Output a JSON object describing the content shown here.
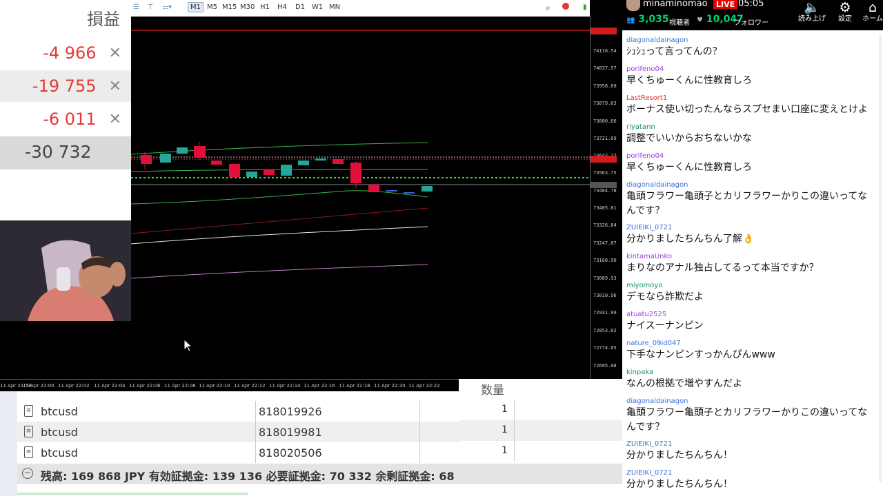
{
  "profit_panel": {
    "title": "損益",
    "rows": [
      {
        "value": "-4 966",
        "close": "✕"
      },
      {
        "value": "-19 755",
        "close": "✕"
      },
      {
        "value": "-6 011",
        "close": "✕"
      }
    ],
    "total": "-30 732"
  },
  "chart": {
    "timeframes": [
      "M1",
      "M5",
      "M15",
      "M30",
      "H1",
      "H4",
      "D1",
      "W1",
      "MN"
    ],
    "active_timeframe": "M1",
    "price_labels": [
      "74116.54",
      "74037.57",
      "73958.60",
      "73879.63",
      "73800.66",
      "73721.69",
      "73642.72",
      "73563.75",
      "73484.78",
      "73405.81",
      "73326.84",
      "73247.87",
      "73168.90",
      "73089.93",
      "73010.96",
      "72931.99",
      "72853.02",
      "72774.05",
      "72695.08"
    ],
    "time_labels": [
      "11 Apr 21:58",
      "11 Apr 22:00",
      "11 Apr 22:02",
      "11 Apr 22:04",
      "11 Apr 22:06",
      "11 Apr 22:08",
      "11 Apr 22:10",
      "11 Apr 22:12",
      "11 Apr 22:14",
      "11 Apr 22:16",
      "11 Apr 22:18",
      "11 Apr 22:20",
      "11 Apr 22:22"
    ],
    "colors": {
      "bull": "#26a69a",
      "bear": "#e0103a"
    }
  },
  "orders": {
    "rows": [
      {
        "symbol": "btcusd",
        "ticket": "818019926",
        "qty": "1"
      },
      {
        "symbol": "btcusd",
        "ticket": "818019981",
        "qty": "1"
      },
      {
        "symbol": "btcusd",
        "ticket": "818020506",
        "qty": "1"
      }
    ],
    "qty_header": "数量",
    "balance_text": "残高: 169 868 JPY  有効証拠金: 139 136  必要証拠金: 70 332  余剰証拠金: 68"
  },
  "stream": {
    "username": "minaminomao",
    "live_label": "LIVE",
    "time": "05:05",
    "viewers": "3,035",
    "viewers_label": "視聴者",
    "followers": "10,047",
    "followers_label": "フォロワー",
    "buttons": [
      {
        "label": "読み上げ",
        "icon": "speaker-icon"
      },
      {
        "label": "設定",
        "icon": "gear-icon"
      },
      {
        "label": "ホーム",
        "icon": "home-icon"
      }
    ]
  },
  "chat": [
    {
      "user": "diagonaldainagon",
      "color": "#3b6fd6",
      "text": "ｼｭｼｭって言ってんの？"
    },
    {
      "user": "porifeno04",
      "color": "#9b3fd6",
      "text": "早くちゅーくんに性教育しろ"
    },
    {
      "user": "LastResort1",
      "color": "#d63b3b",
      "text": "ボーナス使い切ったんならスプセまい口座に変えとけよ"
    },
    {
      "user": "riyatann",
      "color": "#1c8f6a",
      "text": "調整でいいからおちないかな"
    },
    {
      "user": "porifeno04",
      "color": "#9b3fd6",
      "text": "早くちゅーくんに性教育しろ"
    },
    {
      "user": "diagonaldainagon",
      "color": "#3b6fd6",
      "text": "亀頭フラワー亀頭子とカリフラワーかりこの違いってなんです？"
    },
    {
      "user": "ZUIEIKI_0721",
      "color": "#3b6fd6",
      "text": "分かりましたちんちん了解👌"
    },
    {
      "user": "kintamaUnko",
      "color": "#9b3fd6",
      "text": "まりなのアナル独占してるって本当ですか？"
    },
    {
      "user": "miyomoyo",
      "color": "#1c8f6a",
      "text": "デモなら詐欺だよ"
    },
    {
      "user": "atuatu2525",
      "color": "#9b3fd6",
      "text": "ナイスーナンピン"
    },
    {
      "user": "nature_09id047",
      "color": "#3b6fd6",
      "text": "下手なナンピンすっかんぴんwww"
    },
    {
      "user": "kinpaka",
      "color": "#1c8f6a",
      "text": "なんの根拠で増やすんだよ"
    },
    {
      "user": "diagonaldainagon",
      "color": "#3b6fd6",
      "text": "亀頭フラワー亀頭子とカリフラワーかりこの違いってなんです？"
    },
    {
      "user": "ZUIEIKI_0721",
      "color": "#3b6fd6",
      "text": "分かりましたちんちん！"
    },
    {
      "user": "ZUIEIKI_0721",
      "color": "#3b6fd6",
      "text": "分かりましたちんちん！"
    }
  ]
}
